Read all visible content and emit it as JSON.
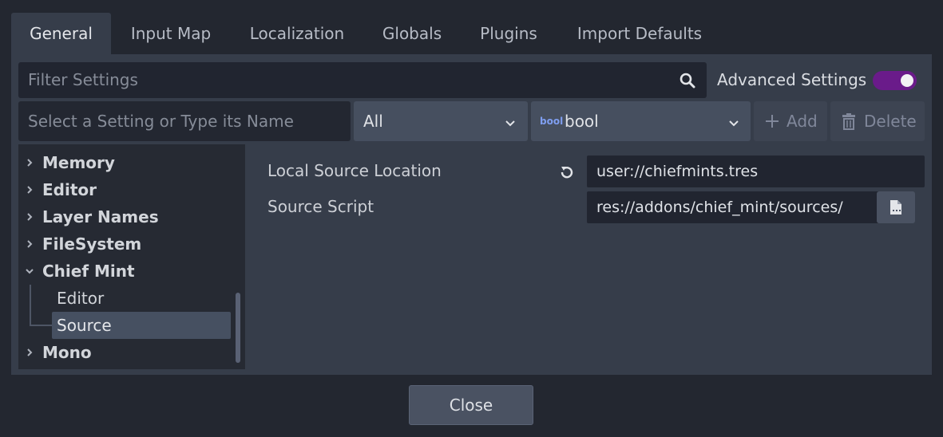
{
  "tabs": [
    {
      "label": "General",
      "active": true
    },
    {
      "label": "Input Map",
      "active": false
    },
    {
      "label": "Localization",
      "active": false
    },
    {
      "label": "Globals",
      "active": false
    },
    {
      "label": "Plugins",
      "active": false
    },
    {
      "label": "Import Defaults",
      "active": false
    }
  ],
  "filter": {
    "placeholder": "Filter Settings",
    "icon": "search-icon"
  },
  "advanced": {
    "label": "Advanced Settings",
    "enabled": true,
    "toggle_color": "#7b1fa2"
  },
  "add_setting": {
    "placeholder": "Select a Setting or Type its Name",
    "scope_value": "All",
    "type_icon_text": "bool",
    "type_value": "bool",
    "add_label": "Add",
    "delete_label": "Delete"
  },
  "tree": {
    "items": [
      {
        "label": "Memory",
        "expanded": false
      },
      {
        "label": "Editor",
        "expanded": false
      },
      {
        "label": "Layer Names",
        "expanded": false
      },
      {
        "label": "FileSystem",
        "expanded": false
      },
      {
        "label": "Chief Mint",
        "expanded": true
      },
      {
        "label": "Mono",
        "expanded": false
      }
    ],
    "children": [
      {
        "label": "Editor",
        "selected": false
      },
      {
        "label": "Source",
        "selected": true
      }
    ]
  },
  "properties": [
    {
      "label": "Local Source Location",
      "value": "user://chiefmints.tres",
      "revert_icon": "revert-icon"
    },
    {
      "label": "Source Script",
      "value": "res://addons/chief_mint/sources/",
      "file_icon": "file-icon"
    }
  ],
  "close_label": "Close"
}
